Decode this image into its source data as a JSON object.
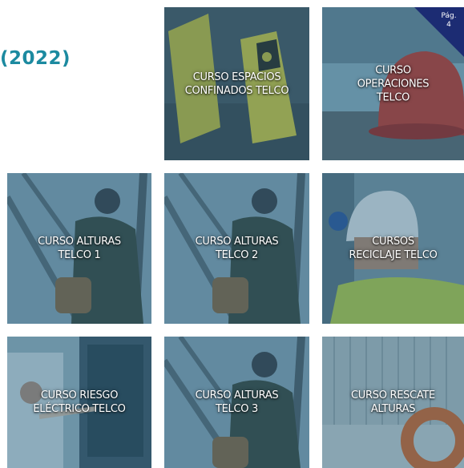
{
  "header": {
    "year": "(2022)"
  },
  "page_badge": {
    "label": "Pág.",
    "number": "4"
  },
  "tiles": [
    {
      "line1": "CURSO ESPACIOS",
      "line2": "CONFINADOS TELCO",
      "line3": ""
    },
    {
      "line1": "CURSO",
      "line2": "OPERACIONES",
      "line3": "TELCO"
    },
    {
      "line1": "CURSO ALTURAS",
      "line2": "TELCO 1",
      "line3": ""
    },
    {
      "line1": "CURSO ALTURAS",
      "line2": "TELCO 2",
      "line3": ""
    },
    {
      "line1": "CURSOS",
      "line2": "RECICLAJE TELCO",
      "line3": ""
    },
    {
      "line1": "CURSO RIESGO",
      "line2": "ELÉCTRICO TELCO",
      "line3": ""
    },
    {
      "line1": "CURSO ALTURAS",
      "line2": "TELCO 3",
      "line3": ""
    },
    {
      "line1": "CURSO RESCATE",
      "line2": "ALTURAS",
      "line3": ""
    }
  ],
  "colors": {
    "accent": "#1c8aa0",
    "badge": "#1c2c73",
    "tint": "#225a78"
  }
}
